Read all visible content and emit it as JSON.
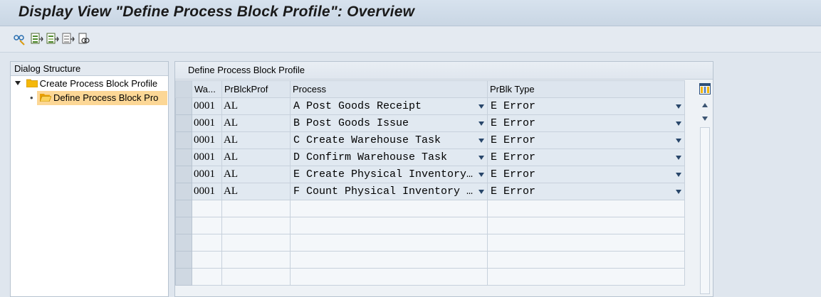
{
  "window": {
    "title": "Display View \"Define Process Block Profile\": Overview"
  },
  "toolbar": {
    "buttons": [
      {
        "icon": "glasses-settings-icon"
      },
      {
        "icon": "select-all-icon"
      },
      {
        "icon": "select-block-icon"
      },
      {
        "icon": "deselect-all-icon"
      },
      {
        "icon": "print-preview-icon"
      }
    ]
  },
  "dialog_structure": {
    "header": "Dialog Structure",
    "items": [
      {
        "label": "Create Process Block Profile",
        "expanded": true
      },
      {
        "label": "Define Process Block Pro",
        "selected": true
      }
    ]
  },
  "table": {
    "title": "Define Process Block Profile",
    "columns": [
      "Wa...",
      "PrBlckProf",
      "Process",
      "PrBlk Type"
    ],
    "rows": [
      {
        "wa": "0001",
        "prof": "AL",
        "process": "A Post Goods Receipt",
        "type": "E Error"
      },
      {
        "wa": "0001",
        "prof": "AL",
        "process": "B Post Goods Issue",
        "type": "E Error"
      },
      {
        "wa": "0001",
        "prof": "AL",
        "process": "C Create Warehouse Task",
        "type": "E Error"
      },
      {
        "wa": "0001",
        "prof": "AL",
        "process": "D Confirm Warehouse Task",
        "type": "E Error"
      },
      {
        "wa": "0001",
        "prof": "AL",
        "process": "E Create Physical Inventory…",
        "type": "E Error"
      },
      {
        "wa": "0001",
        "prof": "AL",
        "process": "F Count Physical Inventory …",
        "type": "E Error"
      }
    ],
    "empty_rows": 5
  },
  "colors": {
    "title_bg": "#d7e2ee",
    "selected_tree_bg": "#fcd796",
    "folder": "#f5b80a",
    "dropdown_arrow": "#28466a"
  }
}
